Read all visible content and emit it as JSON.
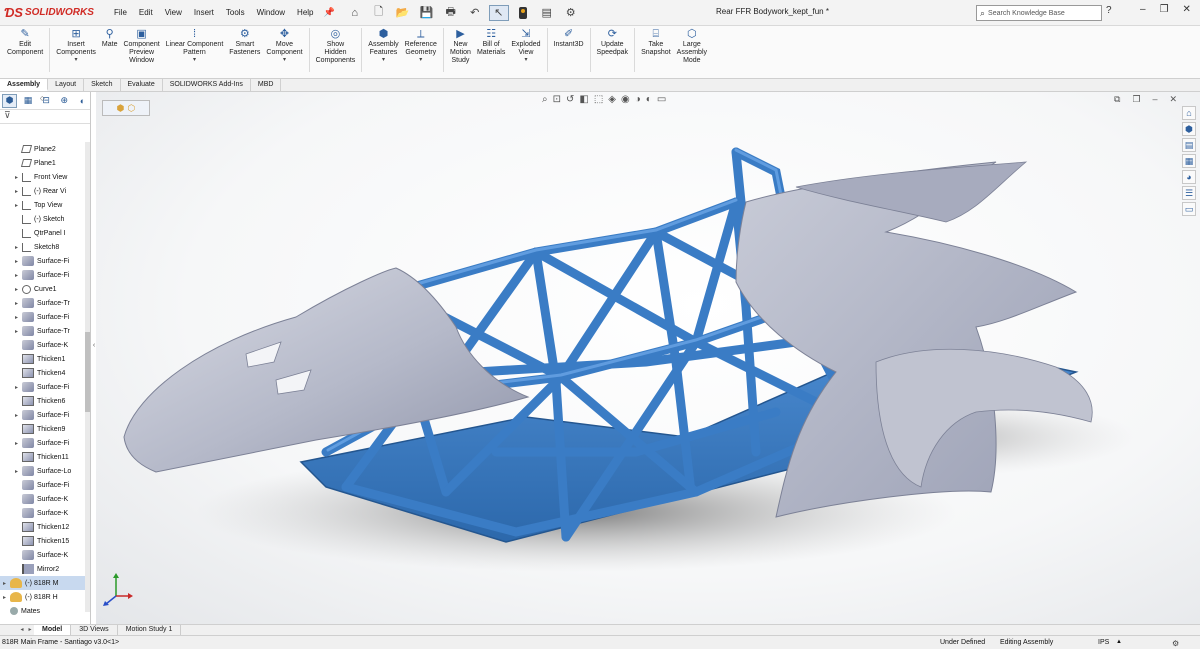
{
  "app": {
    "brand": "SOLIDWORKS",
    "document_title": "Rear FFR Bodywork_kept_fun *"
  },
  "menu": [
    "File",
    "Edit",
    "View",
    "Insert",
    "Tools",
    "Window",
    "Help"
  ],
  "search": {
    "placeholder": "Search Knowledge Base"
  },
  "ribbon": [
    {
      "label": "Edit\nComponent",
      "icon": "edit-component-icon"
    },
    {
      "label": "Insert\nComponents",
      "icon": "insert-components-icon"
    },
    {
      "label": "Mate",
      "icon": "mate-icon"
    },
    {
      "label": "Component\nPreview\nWindow",
      "icon": "component-preview-icon"
    },
    {
      "label": "Linear Component\nPattern",
      "icon": "linear-pattern-icon"
    },
    {
      "label": "Smart\nFasteners",
      "icon": "smart-fasteners-icon"
    },
    {
      "label": "Move\nComponent",
      "icon": "move-component-icon"
    },
    {
      "label": "Show\nHidden\nComponents",
      "icon": "show-hidden-icon"
    },
    {
      "label": "Assembly\nFeatures",
      "icon": "assembly-features-icon"
    },
    {
      "label": "Reference\nGeometry",
      "icon": "reference-geometry-icon"
    },
    {
      "label": "New\nMotion\nStudy",
      "icon": "motion-study-icon"
    },
    {
      "label": "Bill of\nMaterials",
      "icon": "bom-icon"
    },
    {
      "label": "Exploded\nView",
      "icon": "exploded-view-icon"
    },
    {
      "label": "Instant3D",
      "icon": "instant3d-icon"
    },
    {
      "label": "Update\nSpeedpak",
      "icon": "speedpak-icon"
    },
    {
      "label": "Take\nSnapshot",
      "icon": "snapshot-icon"
    },
    {
      "label": "Large\nAssembly\nMode",
      "icon": "large-assembly-icon"
    }
  ],
  "tabs": [
    "Assembly",
    "Layout",
    "Sketch",
    "Evaluate",
    "SOLIDWORKS Add-Ins",
    "MBD"
  ],
  "active_tab": "Assembly",
  "tree": [
    {
      "label": "Plane2",
      "type": "plane",
      "expandable": false
    },
    {
      "label": "Plane1",
      "type": "plane",
      "expandable": false
    },
    {
      "label": "Front View",
      "type": "sketch",
      "expandable": true
    },
    {
      "label": "(-) Rear Vi",
      "type": "sketch",
      "expandable": true
    },
    {
      "label": "Top View",
      "type": "sketch",
      "expandable": true
    },
    {
      "label": "(-) Sketch",
      "type": "sketch",
      "expandable": false
    },
    {
      "label": "QtrPanel I",
      "type": "sketch",
      "expandable": false
    },
    {
      "label": "Sketch8",
      "type": "sketch",
      "expandable": true
    },
    {
      "label": "Surface-Fi",
      "type": "surface",
      "expandable": true
    },
    {
      "label": "Surface-Fi",
      "type": "surface",
      "expandable": true
    },
    {
      "label": "Curve1",
      "type": "curve",
      "expandable": true
    },
    {
      "label": "Surface-Tr",
      "type": "surface",
      "expandable": true
    },
    {
      "label": "Surface-Fi",
      "type": "surface",
      "expandable": true
    },
    {
      "label": "Surface-Tr",
      "type": "surface",
      "expandable": true
    },
    {
      "label": "Surface-K",
      "type": "surface",
      "expandable": false
    },
    {
      "label": "Thicken1",
      "type": "thicken",
      "expandable": false
    },
    {
      "label": "Thicken4",
      "type": "thicken",
      "expandable": false
    },
    {
      "label": "Surface-Fi",
      "type": "surface",
      "expandable": true
    },
    {
      "label": "Thicken6",
      "type": "thicken",
      "expandable": false
    },
    {
      "label": "Surface-Fi",
      "type": "surface",
      "expandable": true
    },
    {
      "label": "Thicken9",
      "type": "thicken",
      "expandable": false
    },
    {
      "label": "Surface-Fi",
      "type": "surface",
      "expandable": true
    },
    {
      "label": "Thicken11",
      "type": "thicken",
      "expandable": false
    },
    {
      "label": "Surface-Lo",
      "type": "surface",
      "expandable": true
    },
    {
      "label": "Surface-Fi",
      "type": "surface",
      "expandable": false
    },
    {
      "label": "Surface-K",
      "type": "surface",
      "expandable": false
    },
    {
      "label": "Surface-K",
      "type": "surface",
      "expandable": false
    },
    {
      "label": "Thicken12",
      "type": "thicken",
      "expandable": false
    },
    {
      "label": "Thicken15",
      "type": "thicken",
      "expandable": false
    },
    {
      "label": "Surface-K",
      "type": "surface",
      "expandable": false
    },
    {
      "label": "Mirror2",
      "type": "mirror",
      "expandable": false
    },
    {
      "label": "(-) 818R M",
      "type": "part",
      "expandable": true,
      "top_level": true,
      "selected": true
    },
    {
      "label": "(-) 818R H",
      "type": "part",
      "expandable": true,
      "top_level": true
    },
    {
      "label": "Mates",
      "type": "mates",
      "expandable": false,
      "top_level": true
    }
  ],
  "bottom_tabs": [
    "Model",
    "3D Views",
    "Motion Study 1"
  ],
  "active_bottom_tab": "Model",
  "status": {
    "left": "818R Main Frame - Santiago v3.0<1>",
    "definition": "Under Defined",
    "mode": "Editing Assembly",
    "units": "IPS"
  },
  "colors": {
    "frame_blue": "#3b7dc4",
    "body_grey": "#b8bccb",
    "brand_red": "#d02a24"
  }
}
